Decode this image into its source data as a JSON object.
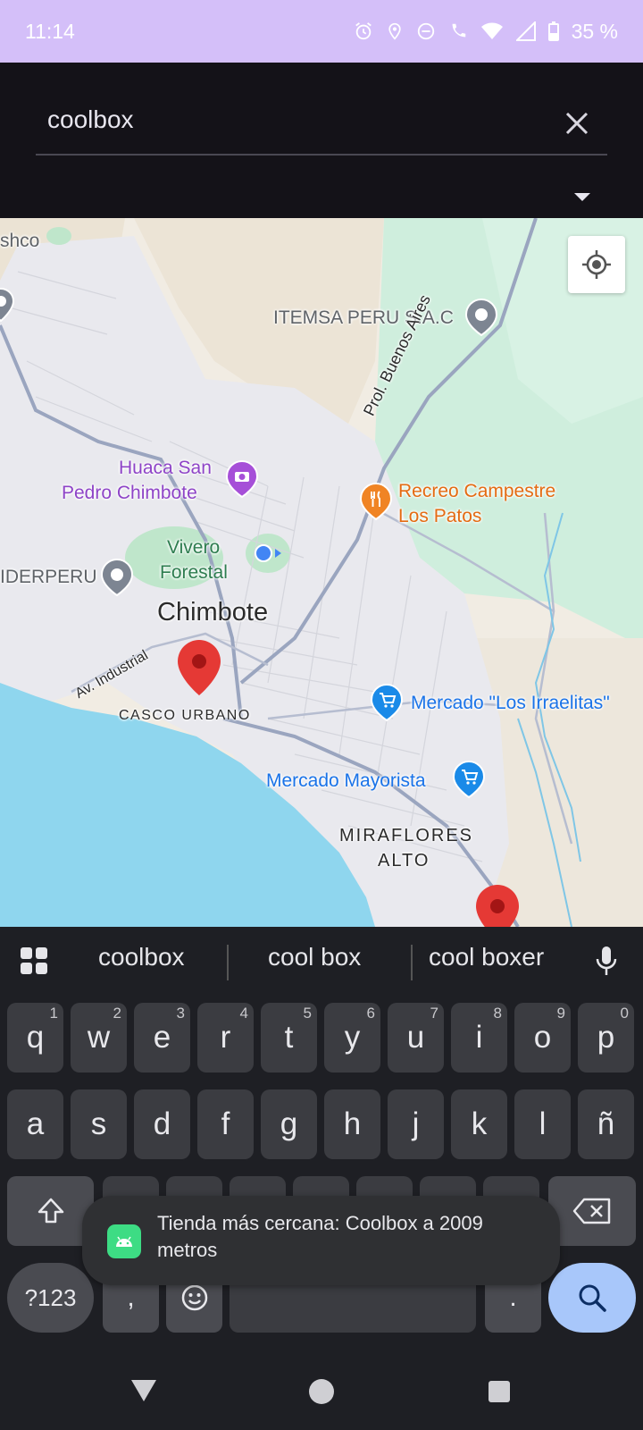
{
  "status_bar": {
    "time": "11:14",
    "battery": "35 %"
  },
  "search": {
    "query": "coolbox"
  },
  "map": {
    "labels": {
      "shco": "shco",
      "itemsa": "ITEMSA PERU S.A.C",
      "buenos_aires": "Prol. Buenos Aires",
      "huaca_1": "Huaca San",
      "huaca_2": "Pedro Chimbote",
      "recreo_1": "Recreo Campestre",
      "recreo_2": "Los Patos",
      "vivero_1": "Vivero",
      "vivero_2": "Forestal",
      "iderperu": "IDERPERU",
      "chimbote": "Chimbote",
      "av_industrial": "Av. Industrial",
      "casco_urbano": "CASCO URBANO",
      "mercado_irraelitas": "Mercado \"Los Irraelitas\"",
      "mercado_mayorista": "Mercado Mayorista",
      "miraflores_1": "MIRAFLORES",
      "miraflores_2": "ALTO"
    }
  },
  "keyboard": {
    "suggestions": [
      "coolbox",
      "cool box",
      "cool boxer"
    ],
    "row1": [
      {
        "k": "q",
        "h": "1"
      },
      {
        "k": "w",
        "h": "2"
      },
      {
        "k": "e",
        "h": "3"
      },
      {
        "k": "r",
        "h": "4"
      },
      {
        "k": "t",
        "h": "5"
      },
      {
        "k": "y",
        "h": "6"
      },
      {
        "k": "u",
        "h": "7"
      },
      {
        "k": "i",
        "h": "8"
      },
      {
        "k": "o",
        "h": "9"
      },
      {
        "k": "p",
        "h": "0"
      }
    ],
    "row2": [
      "a",
      "s",
      "d",
      "f",
      "g",
      "h",
      "j",
      "k",
      "l",
      "ñ"
    ],
    "symbols_key": "?123",
    "comma_key": ",",
    "period_key": "."
  },
  "toast": {
    "message": "Tienda más cercana: Coolbox a 2009 metros"
  },
  "colors": {
    "status_bar": "#d4bff9",
    "header": "#141218",
    "water": "#8fd6ee",
    "park": "#c8eed6",
    "pin_red": "#e53935",
    "accent_blue": "#a8c7fa"
  }
}
